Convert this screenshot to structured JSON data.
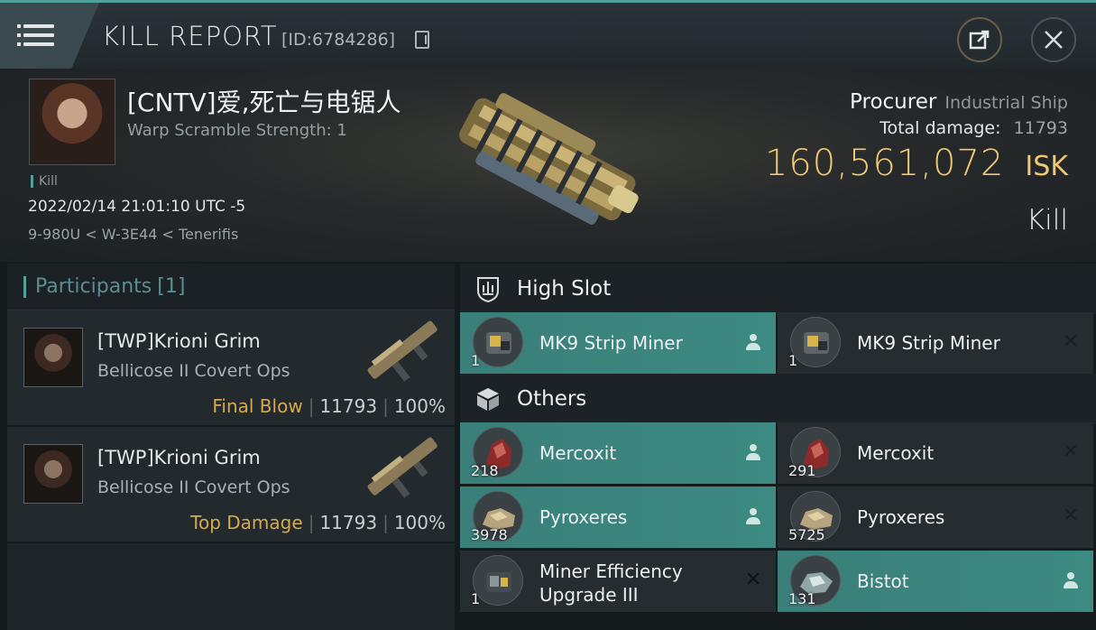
{
  "header": {
    "title": "KILL REPORT",
    "kill_id": "[ID:6784286]",
    "share_icon": "share-external-icon",
    "close_icon": "close-icon"
  },
  "victim": {
    "name": "[CNTV]爱,死亡与电锯人",
    "warp_scramble": "Warp Scramble Strength: 1",
    "kill_tag": "Kill",
    "datetime": "2022/02/14 21:01:10 UTC -5",
    "location": "9-980U < W-3E44 < Tenerifis",
    "ship_name": "Procurer",
    "ship_class": "Industrial Ship",
    "total_damage_label": "Total damage:",
    "total_damage": "11793",
    "isk_value": "160,561,072",
    "isk_unit": "ISK",
    "result": "Kill"
  },
  "participants": {
    "title": "Participants",
    "count": "[1]",
    "rows": [
      {
        "name": "[TWP]Krioni Grim",
        "ship": "Bellicose II Covert Ops",
        "tag": "Final Blow",
        "damage": "11793",
        "percent": "100%"
      },
      {
        "name": "[TWP]Krioni Grim",
        "ship": "Bellicose II Covert Ops",
        "tag": "Top Damage",
        "damage": "11793",
        "percent": "100%"
      }
    ]
  },
  "sections": {
    "high_slot": "High Slot",
    "others": "Others"
  },
  "items": {
    "high": [
      {
        "name": "MK9 Strip Miner",
        "qty": "1",
        "status": "dropped"
      },
      {
        "name": "MK9 Strip Miner",
        "qty": "1",
        "status": "destroyed"
      }
    ],
    "others": [
      {
        "name": "Mercoxit",
        "qty": "218",
        "status": "dropped"
      },
      {
        "name": "Mercoxit",
        "qty": "291",
        "status": "destroyed"
      },
      {
        "name": "Pyroxeres",
        "qty": "3978",
        "status": "dropped"
      },
      {
        "name": "Pyroxeres",
        "qty": "5725",
        "status": "destroyed"
      },
      {
        "name_line1": "Miner Efficiency",
        "name_line2": "Upgrade III",
        "qty": "1",
        "status": "destroyed"
      },
      {
        "name": "Bistot",
        "qty": "131",
        "status": "dropped"
      }
    ]
  },
  "colors": {
    "accent": "#4fa39a",
    "isk": "#f1c774",
    "dropped_row": "#3c8a82",
    "tag": "#d4a951"
  }
}
